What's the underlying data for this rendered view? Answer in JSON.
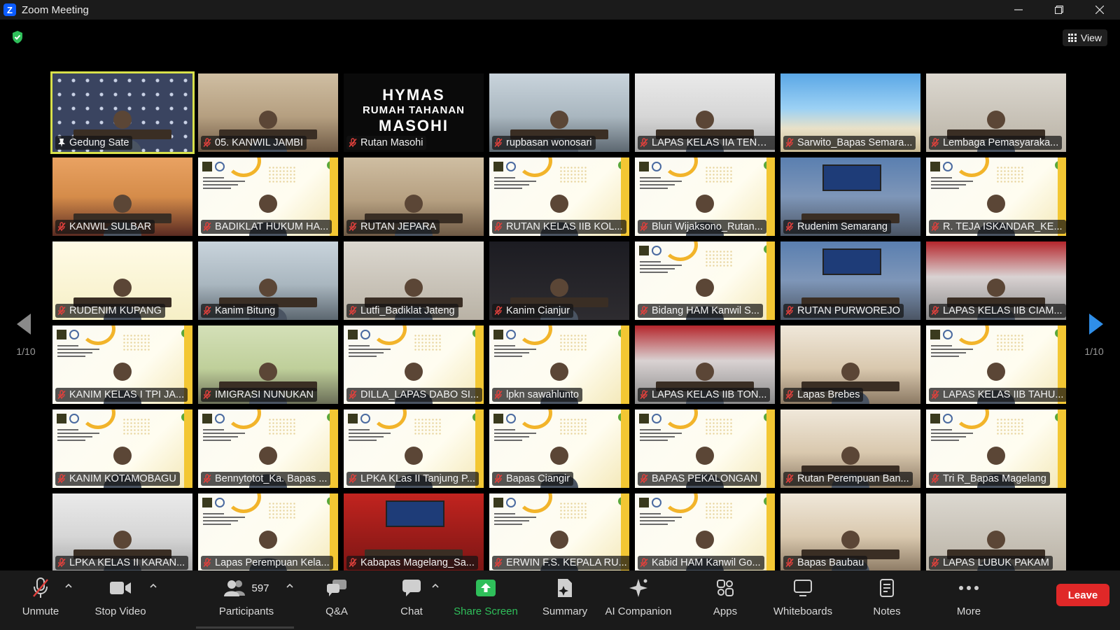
{
  "window": {
    "title": "Zoom Meeting"
  },
  "view_label": "View",
  "page_indicator_left": "1/10",
  "page_indicator_right": "1/10",
  "tiles": [
    {
      "name": "Gedung Sate",
      "scene": "pattern",
      "muted": false,
      "active": true
    },
    {
      "name": "05. KANWIL JAMBI",
      "scene": "room-warm",
      "muted": true
    },
    {
      "name": "Rutan Masohi",
      "scene": "hymas",
      "muted": true
    },
    {
      "name": "rupbasan wonosari",
      "scene": "room-cool",
      "muted": true
    },
    {
      "name": "LAPAS KELAS IIA TENG...",
      "scene": "office",
      "muted": true
    },
    {
      "name": "Sarwito_Bapas Semara...",
      "scene": "beach",
      "muted": true
    },
    {
      "name": "Lembaga Pemasyaraka...",
      "scene": "portrait",
      "muted": true
    },
    {
      "name": "KANWIL SULBAR",
      "scene": "orange",
      "muted": true
    },
    {
      "name": "BADIKLAT HUKUM HA...",
      "scene": "slide",
      "muted": true
    },
    {
      "name": "RUTAN JEPARA",
      "scene": "room-warm",
      "muted": true
    },
    {
      "name": "RUTAN KELAS IIB KOL...",
      "scene": "slide",
      "muted": true
    },
    {
      "name": "Bluri Wijaksono_Rutan...",
      "scene": "slide",
      "muted": true
    },
    {
      "name": "Rudenim Semarang",
      "scene": "room-blue",
      "muted": true
    },
    {
      "name": "R. TEJA ISKANDAR_KE...",
      "scene": "slide",
      "muted": true
    },
    {
      "name": "RUDENIM KUPANG",
      "scene": "launch",
      "muted": true
    },
    {
      "name": "Kanim Bitung",
      "scene": "room-cool",
      "muted": true
    },
    {
      "name": "Lutfi_Badiklat Jateng",
      "scene": "portrait",
      "muted": true
    },
    {
      "name": "Kanim Cianjur",
      "scene": "dark",
      "muted": true
    },
    {
      "name": "Bidang HAM Kanwil S...",
      "scene": "slide",
      "muted": true
    },
    {
      "name": "RUTAN PURWOREJO",
      "scene": "room-blue",
      "muted": true
    },
    {
      "name": "LAPAS KELAS IIB CIAM...",
      "scene": "room-red",
      "muted": true
    },
    {
      "name": "KANIM KELAS I TPI JA...",
      "scene": "slide",
      "muted": true
    },
    {
      "name": "IMIGRASI NUNUKAN",
      "scene": "green",
      "muted": true
    },
    {
      "name": "DILLA_LAPAS DABO SI...",
      "scene": "slide",
      "muted": true
    },
    {
      "name": "lpkn sawahlunto",
      "scene": "slide",
      "muted": true
    },
    {
      "name": "LAPAS KELAS IIB TON...",
      "scene": "room-red",
      "muted": true
    },
    {
      "name": "Lapas Brebes",
      "scene": "class",
      "muted": true
    },
    {
      "name": "LAPAS KELAS IIB TAHU...",
      "scene": "slide",
      "muted": true
    },
    {
      "name": "KANIM KOTAMOBAGU",
      "scene": "slide",
      "muted": true
    },
    {
      "name": "Bennytotot_Ka. Bapas ...",
      "scene": "slide",
      "muted": true
    },
    {
      "name": "LPKA KLas II Tanjung P...",
      "scene": "slide",
      "muted": true
    },
    {
      "name": "Bapas Ciangir",
      "scene": "slide",
      "muted": true
    },
    {
      "name": "BAPAS PEKALONGAN",
      "scene": "slide",
      "muted": true
    },
    {
      "name": "Rutan Perempuan Ban...",
      "scene": "class",
      "muted": true
    },
    {
      "name": "Tri R_Bapas Magelang",
      "scene": "slide",
      "muted": true
    },
    {
      "name": "LPKA KELAS II KARAN...",
      "scene": "office",
      "muted": true
    },
    {
      "name": "Lapas Perempuan Kela...",
      "scene": "slide",
      "muted": true
    },
    {
      "name": "Kabapas Magelang_Sa...",
      "scene": "red2",
      "muted": true
    },
    {
      "name": "ERWIN F.S. KEPALA RU...",
      "scene": "slide",
      "muted": true
    },
    {
      "name": "Kabid HAM Kanwil Go...",
      "scene": "slide",
      "muted": true
    },
    {
      "name": "Bapas Baubau",
      "scene": "class",
      "muted": true
    },
    {
      "name": "LAPAS LUBUK PAKAM",
      "scene": "portrait",
      "muted": true
    }
  ],
  "hymas_text": {
    "l1": "HYMAS",
    "l2": "RUMAH TAHANAN",
    "l3": "MASOHI"
  },
  "toolbar": {
    "unmute": "Unmute",
    "stop_video": "Stop Video",
    "participants": "Participants",
    "participants_count": "597",
    "qa": "Q&A",
    "chat": "Chat",
    "share_screen": "Share Screen",
    "summary": "Summary",
    "ai_companion": "AI Companion",
    "apps": "Apps",
    "whiteboards": "Whiteboards",
    "notes": "Notes",
    "more": "More",
    "leave": "Leave"
  },
  "colors": {
    "accent_green": "#2fbf5a",
    "leave_red": "#e02828",
    "active_border": "#d8e04a",
    "muted_red": "#e0403c"
  }
}
